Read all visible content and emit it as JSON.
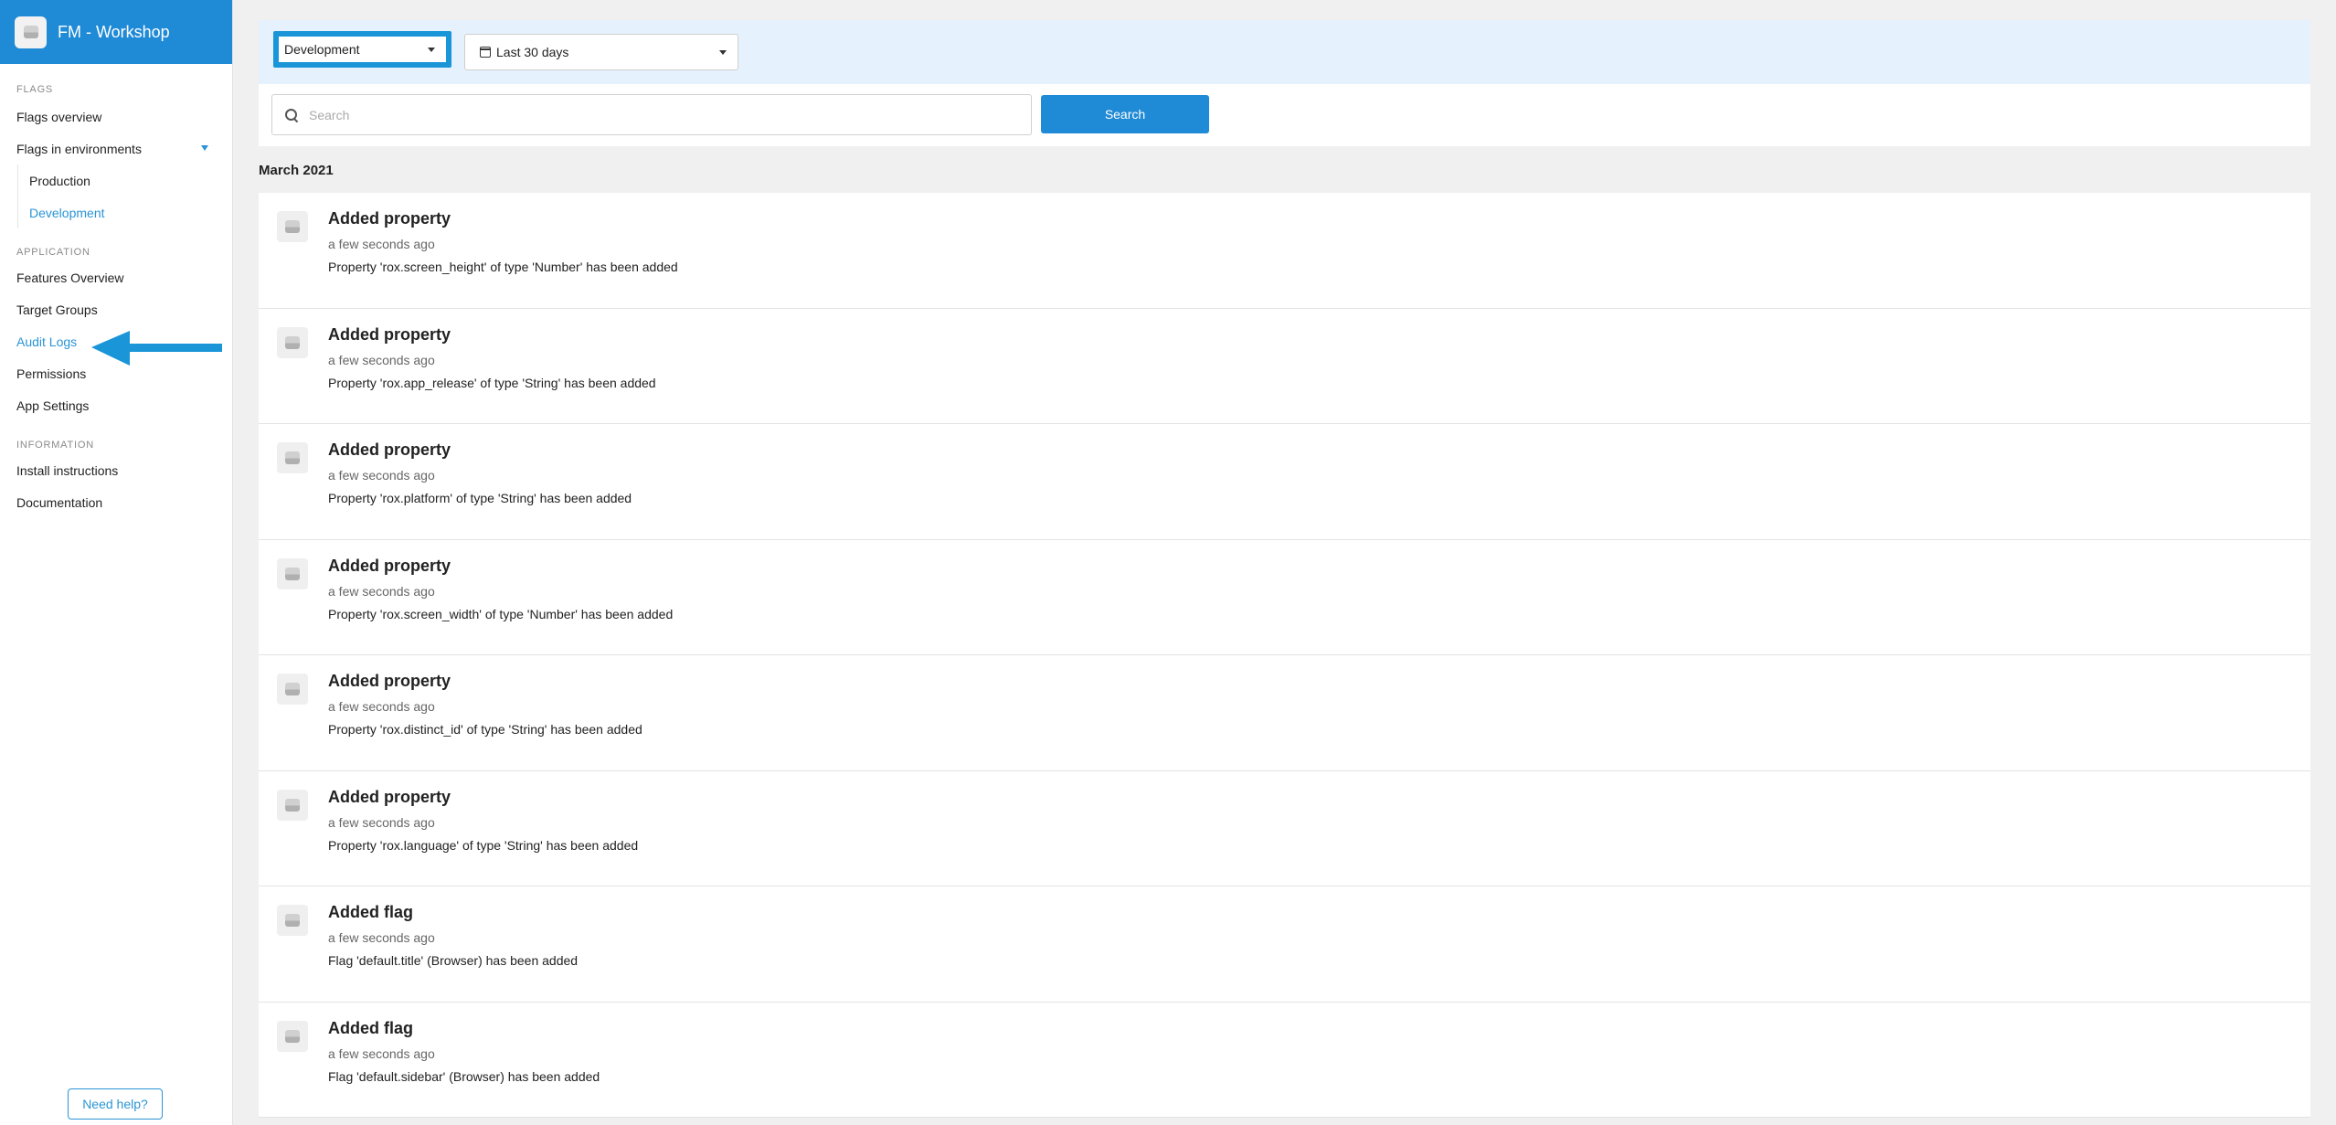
{
  "app": {
    "title": "FM - Workshop"
  },
  "sidebar": {
    "sections": {
      "flags": "FLAGS",
      "application": "APPLICATION",
      "information": "INFORMATION"
    },
    "items": {
      "flags_overview": "Flags overview",
      "flags_in_env": "Flags in environments",
      "production": "Production",
      "development": "Development",
      "features_overview": "Features Overview",
      "target_groups": "Target Groups",
      "audit_logs": "Audit Logs",
      "permissions": "Permissions",
      "app_settings": "App Settings",
      "install_instructions": "Install instructions",
      "documentation": "Documentation"
    },
    "active_item": "audit_logs",
    "help_label": "Need help?"
  },
  "annotation": {
    "arrow_color": "#1a95d8"
  },
  "filters": {
    "environment": "Development",
    "date_range": "Last 30 days"
  },
  "search": {
    "placeholder": "Search",
    "button_label": "Search"
  },
  "colors": {
    "accent": "#1f8ad6",
    "filter_bg": "#e5f1fc"
  },
  "month_heading": "March 2021",
  "logs": [
    {
      "title": "Added property",
      "time": "a few seconds ago",
      "desc": "Property 'rox.screen_height' of type 'Number' has been added"
    },
    {
      "title": "Added property",
      "time": "a few seconds ago",
      "desc": "Property 'rox.app_release' of type 'String' has been added"
    },
    {
      "title": "Added property",
      "time": "a few seconds ago",
      "desc": "Property 'rox.platform' of type 'String' has been added"
    },
    {
      "title": "Added property",
      "time": "a few seconds ago",
      "desc": "Property 'rox.screen_width' of type 'Number' has been added"
    },
    {
      "title": "Added property",
      "time": "a few seconds ago",
      "desc": "Property 'rox.distinct_id' of type 'String' has been added"
    },
    {
      "title": "Added property",
      "time": "a few seconds ago",
      "desc": "Property 'rox.language' of type 'String' has been added"
    },
    {
      "title": "Added flag",
      "time": "a few seconds ago",
      "desc": "Flag 'default.title' (Browser) has been added"
    },
    {
      "title": "Added flag",
      "time": "a few seconds ago",
      "desc": "Flag 'default.sidebar' (Browser) has been added"
    }
  ]
}
